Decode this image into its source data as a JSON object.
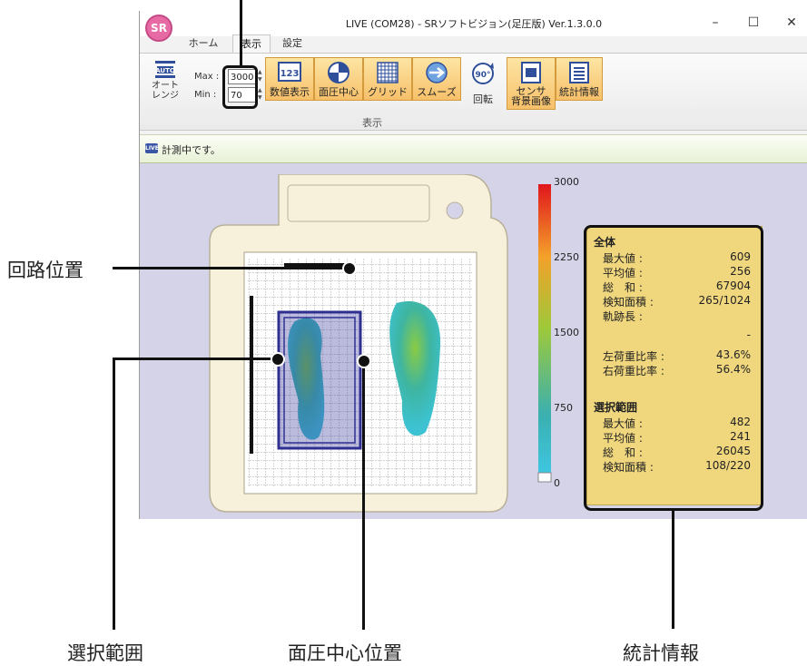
{
  "window": {
    "title": "LIVE (COM28) - SRソフトビジョン(足圧版) Ver.1.3.0.0",
    "app_icon_text": "SR",
    "controls": {
      "minimize": "–",
      "maximize": "☐",
      "close": "✕"
    }
  },
  "tabs": [
    {
      "label": "ホーム",
      "active": false
    },
    {
      "label": "表示",
      "active": true
    },
    {
      "label": "設定",
      "active": false
    }
  ],
  "ribbon": {
    "group_label": "表示",
    "auto_range": {
      "badge": "AUTO",
      "label_line1": "オート",
      "label_line2": "レンジ"
    },
    "max_label": "Max :",
    "max_value": "3000",
    "min_label": "Min :",
    "min_value": "70",
    "buttons": {
      "numeric": "数値表示",
      "numeric_icon_text": "123",
      "center": "面圧中心",
      "grid": "グリッド",
      "smooth": "スムーズ",
      "rotate": "回転",
      "rotate_icon_text": "90°",
      "sensor_line1": "センサ",
      "sensor_line2": "背景画像",
      "stats": "統計情報"
    },
    "toggle_color": "#f7c06a"
  },
  "status": {
    "badge": "LIVE",
    "text": "計測中です。"
  },
  "scale": {
    "max": "3000",
    "t2250": "2250",
    "t1500": "1500",
    "t750": "750",
    "min": "0"
  },
  "stats": {
    "overall_title": "全体",
    "max_label": "最大値 :",
    "max_value": "609",
    "avg_label": "平均値 :",
    "avg_value": "256",
    "sum_label": "総　和 :",
    "sum_value": "67904",
    "area_label": "検知面積 :",
    "area_value": "265/1024",
    "track_label": "軌跡長 :",
    "track_value": "-",
    "left_label": "左荷重比率 :",
    "left_value": "43.6%",
    "right_label": "右荷重比率 :",
    "right_value": "56.4%",
    "sel_title": "選択範囲",
    "sel_max_label": "最大値 :",
    "sel_max_value": "482",
    "sel_avg_label": "平均値 :",
    "sel_avg_value": "241",
    "sel_sum_label": "総　和 :",
    "sel_sum_value": "26045",
    "sel_area_label": "検知面積 :",
    "sel_area_value": "108/220"
  },
  "callouts": {
    "circuit": "回路位置",
    "selection": "選択範囲",
    "center": "面圧中心位置",
    "stats": "統計情報"
  }
}
